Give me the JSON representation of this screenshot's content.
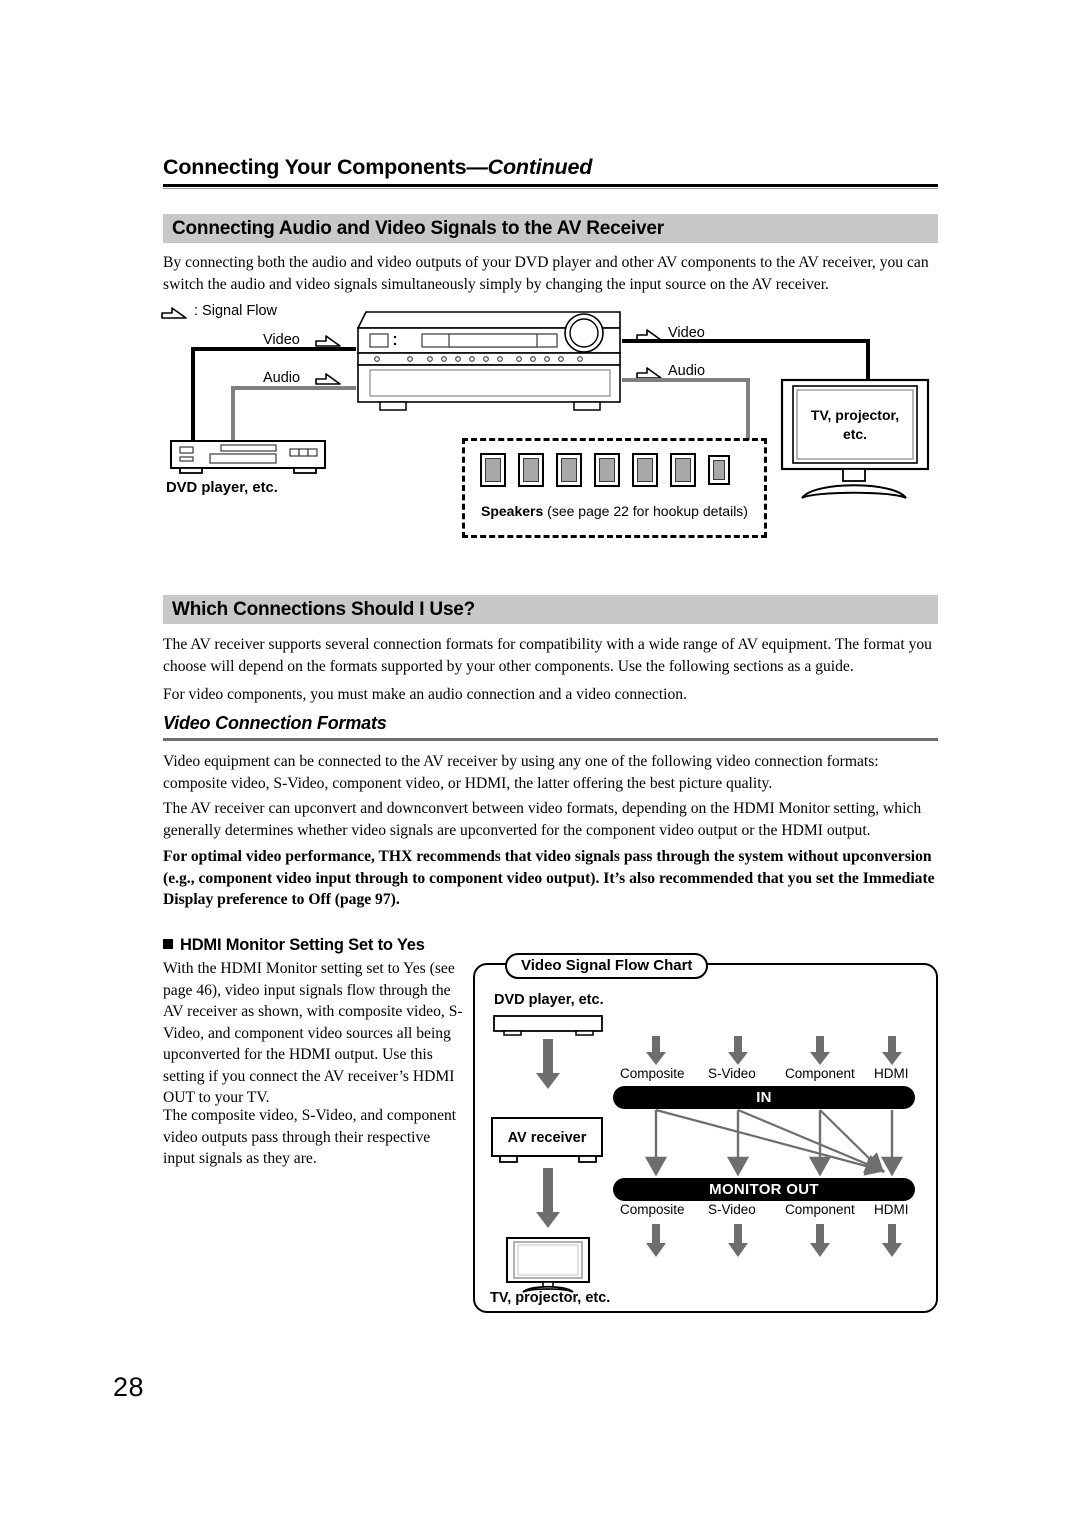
{
  "page": {
    "number": "28",
    "running_head_main": "Connecting Your Components",
    "running_head_cont": "—Continued"
  },
  "section1": {
    "heading": "Connecting Audio and Video Signals to the AV Receiver",
    "paragraph": "By connecting both the audio and video outputs of your DVD player and other AV components to the AV receiver, you can switch the audio and video signals simultaneously simply by changing the input source on the AV receiver."
  },
  "hookup_diagram": {
    "legend": ": Signal Flow",
    "left_video": "Video",
    "left_audio": "Audio",
    "right_video": "Video",
    "right_audio": "Audio",
    "dvd_label": "DVD player, etc.",
    "tv_label_line1": "TV, projector,",
    "tv_label_line2": "etc.",
    "speakers_label_bold": "Speakers",
    "speakers_label_rest": " (see page 22 for hookup details)",
    "speaker_count": 7
  },
  "section2": {
    "heading": "Which Connections Should I Use?",
    "paragraph1": "The AV receiver supports several connection formats for compatibility with a wide range of AV equipment. The format you choose will depend on the formats supported by your other components. Use the following sections as a guide.",
    "paragraph2": "For video components, you must make an audio connection and a video connection."
  },
  "subsection": {
    "heading": "Video Connection Formats",
    "paragraph1": "Video equipment can be connected to the AV receiver by using any one of the following video connection formats: composite video, S-Video, component video, or HDMI, the latter offering the best picture quality.",
    "paragraph2": "The AV receiver can upconvert and downconvert between video formats, depending on the HDMI Monitor setting, which generally determines whether video signals are upconverted for the component video output or the HDMI output.",
    "paragraph3_bold": "For optimal video performance, THX recommends that video signals pass through the system without upconversion (e.g., component video input through to component video output). It’s also recommended that you set the Immediate Display preference to Off (page 97)."
  },
  "hdmi_block": {
    "heading": "HDMI Monitor Setting Set to Yes",
    "paragraph1": "With the HDMI Monitor setting set to Yes (see page 46), video input signals flow through the AV receiver as shown, with composite video, S-Video, and component video sources all being upconverted for the HDMI output. Use this setting if you connect the AV receiver’s HDMI OUT to your TV.",
    "paragraph2": "The composite video, S-Video, and component video outputs pass through their respective input signals as they are."
  },
  "chart_data": {
    "type": "diagram",
    "title": "Video Signal Flow Chart",
    "source_label": "DVD player, etc.",
    "device_label": "AV receiver",
    "sink_label": "TV, projector, etc.",
    "in_bar_label": "IN",
    "out_bar_label": "MONITOR OUT",
    "input_formats": [
      "Composite",
      "S-Video",
      "Component",
      "HDMI"
    ],
    "output_formats": [
      "Composite",
      "S-Video",
      "Component",
      "HDMI"
    ],
    "routes": [
      {
        "from": "Composite",
        "to": "Composite",
        "kind": "pass-through"
      },
      {
        "from": "S-Video",
        "to": "S-Video",
        "kind": "pass-through"
      },
      {
        "from": "Component",
        "to": "Component",
        "kind": "pass-through"
      },
      {
        "from": "HDMI",
        "to": "HDMI",
        "kind": "pass-through"
      },
      {
        "from": "Composite",
        "to": "HDMI",
        "kind": "upconvert"
      },
      {
        "from": "S-Video",
        "to": "HDMI",
        "kind": "upconvert"
      },
      {
        "from": "Component",
        "to": "HDMI",
        "kind": "upconvert"
      }
    ],
    "colors": {
      "bar": "#000000",
      "arrow": "#6e6e6e",
      "outline": "#000000"
    }
  }
}
